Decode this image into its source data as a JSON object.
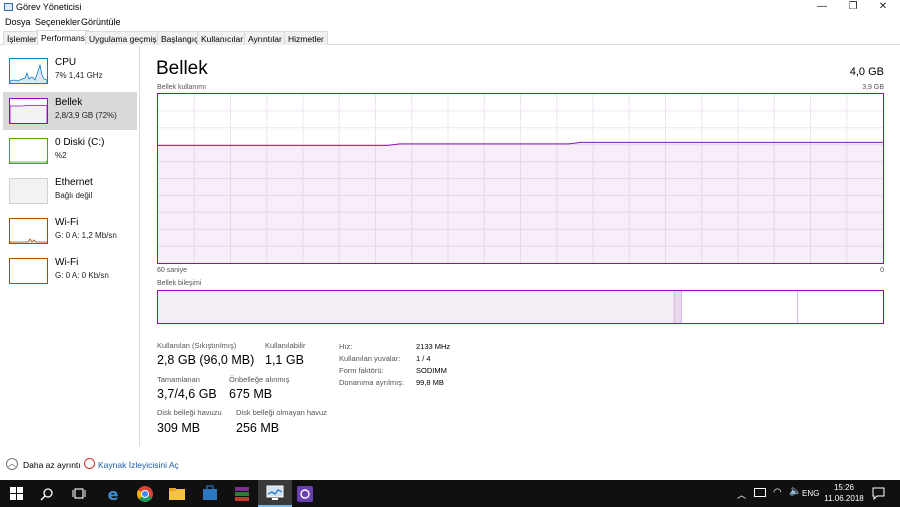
{
  "window": {
    "title": "Görev Yöneticisi",
    "minimize": "—",
    "restore": "❐",
    "close": "✕"
  },
  "menu": [
    "Dosya",
    "Seçenekler",
    "Görüntüle"
  ],
  "tabs": [
    "İşlemler",
    "Performans",
    "Uygulama geçmişi",
    "Başlangıç",
    "Kullanıcılar",
    "Ayrıntılar",
    "Hizmetler"
  ],
  "sidebar": {
    "items": [
      {
        "name": "CPU",
        "sub": "7% 1,41 GHz",
        "color": "#117dbb"
      },
      {
        "name": "Bellek",
        "sub": "2,8/3,9 GB (72%)",
        "color": "#8b12ae"
      },
      {
        "name": "0 Diski (C:)",
        "sub": "%2",
        "color": "#4da60c"
      },
      {
        "name": "Ethernet",
        "sub": "Bağlı değil",
        "color": "#a0a0a0"
      },
      {
        "name": "Wi-Fi",
        "sub": "G: 0 A: 1,2 Mb/sn",
        "color": "#a74f01"
      },
      {
        "name": "Wi-Fi",
        "sub": "G: 0 A: 0 Kb/sn",
        "color": "#a74f01"
      }
    ]
  },
  "main": {
    "title": "Bellek",
    "total": "4,0 GB",
    "usage_label": "Bellek kullanımı",
    "usage_max": "3,9 GB",
    "time_left": "60 saniye",
    "time_right": "0",
    "composition_label": "Bellek bileşimi",
    "usage_level_fraction": 0.705,
    "composition": {
      "in_use_fraction": 0.712,
      "modified_fraction": 0.01,
      "standby_fraction": 0.16
    }
  },
  "stats": {
    "in_use_label": "Kullanılan (Sıkıştırılmış)",
    "in_use": "2,8 GB (96,0 MB)",
    "available_label": "Kullanılabilir",
    "available": "1,1 GB",
    "committed_label": "Tamamlanan",
    "committed": "3,7/4,6 GB",
    "cached_label": "Önbelleğe alınmış",
    "cached": "675 MB",
    "paged_label": "Disk belleği havuzu",
    "paged": "309 MB",
    "nonpaged_label": "Disk belleği olmayan havuz",
    "nonpaged": "256 MB"
  },
  "specs": [
    {
      "k": "Hız:",
      "v": "2133 MHz"
    },
    {
      "k": "Kullanılan yuvalar:",
      "v": "1 / 4"
    },
    {
      "k": "Form faktörü:",
      "v": "SODIMM"
    },
    {
      "k": "Donanıma ayrılmış:",
      "v": "99,8 MB"
    }
  ],
  "footer": {
    "less_details": "Daha az ayrıntı",
    "resource_monitor": "Kaynak İzleyicisini Aç"
  },
  "taskbar": {
    "lang": "ENG",
    "time": "15:26",
    "date": "11.06.2018"
  }
}
